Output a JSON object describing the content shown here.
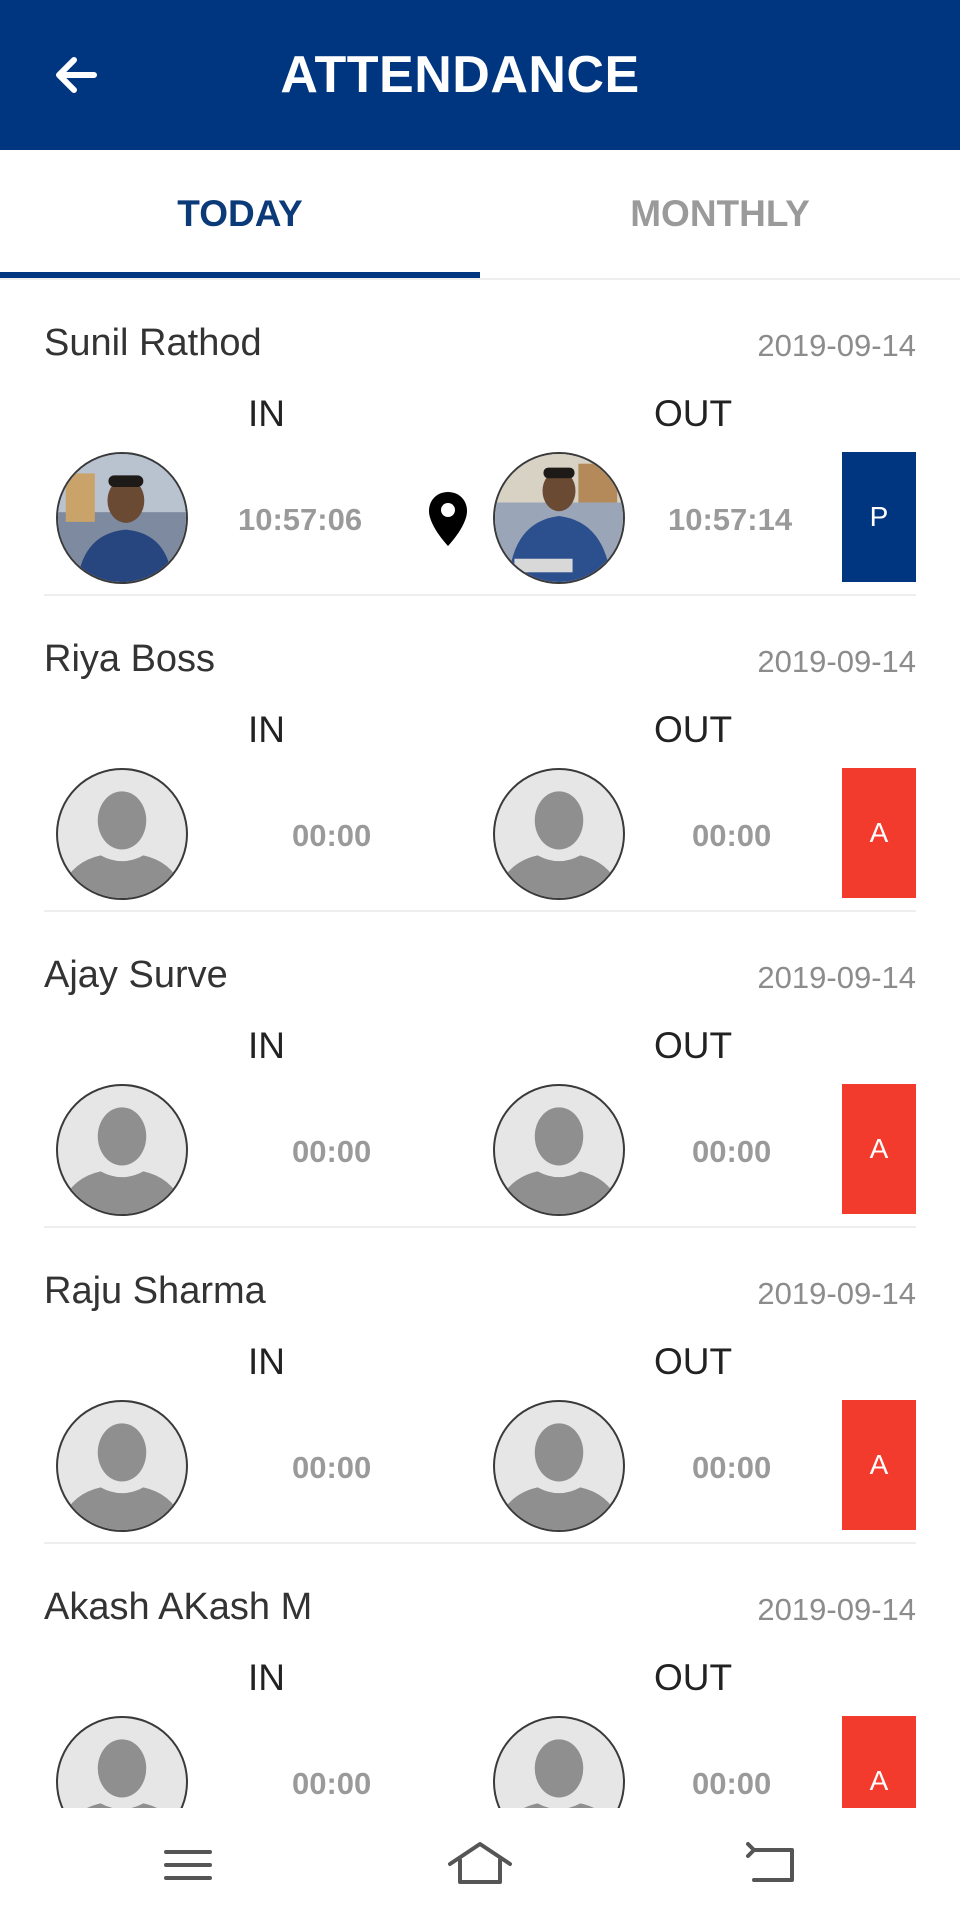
{
  "header": {
    "title": "ATTENDANCE",
    "back_icon": "arrow-left-icon"
  },
  "tabs": [
    {
      "label": "TODAY",
      "active": true
    },
    {
      "label": "MONTHLY",
      "active": false
    }
  ],
  "colors": {
    "primary": "#003580",
    "present": "#003580",
    "absent": "#f23b2d",
    "tab_active_text": "#0a3a78",
    "tab_inactive_text": "#9a9a9a"
  },
  "labels": {
    "in": "IN",
    "out": "OUT"
  },
  "records": [
    {
      "name": "Sunil Rathod",
      "date": "2019-09-14",
      "in_time": "10:57:06",
      "out_time": "10:57:14",
      "status": "P",
      "has_photo": true,
      "has_location": true
    },
    {
      "name": "Riya Boss",
      "date": "2019-09-14",
      "in_time": "00:00",
      "out_time": "00:00",
      "status": "A",
      "has_photo": false,
      "has_location": false
    },
    {
      "name": "Ajay Surve",
      "date": "2019-09-14",
      "in_time": "00:00",
      "out_time": "00:00",
      "status": "A",
      "has_photo": false,
      "has_location": false
    },
    {
      "name": "Raju Sharma",
      "date": "2019-09-14",
      "in_time": "00:00",
      "out_time": "00:00",
      "status": "A",
      "has_photo": false,
      "has_location": false
    },
    {
      "name": "Akash AKash M",
      "date": "2019-09-14",
      "in_time": "00:00",
      "out_time": "00:00",
      "status": "A",
      "has_photo": false,
      "has_location": false
    }
  ],
  "navbar": {
    "items": [
      "menu-icon",
      "home-icon",
      "back-icon"
    ]
  }
}
